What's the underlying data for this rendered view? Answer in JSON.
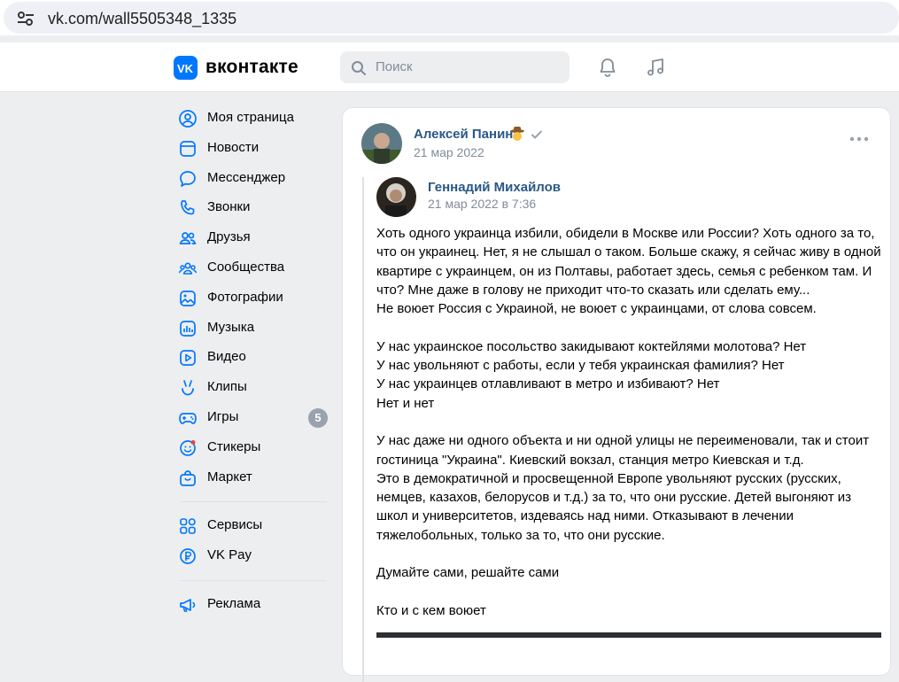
{
  "browser": {
    "url": "vk.com/wall5505348_1335"
  },
  "header": {
    "logo_text": "вконтакте",
    "search_placeholder": "Поиск",
    "accent": "#0077ff"
  },
  "sidebar": {
    "items": [
      {
        "label": "Моя страница",
        "icon": "user-circle-icon"
      },
      {
        "label": "Новости",
        "icon": "news-icon"
      },
      {
        "label": "Мессенджер",
        "icon": "message-icon"
      },
      {
        "label": "Звонки",
        "icon": "phone-icon"
      },
      {
        "label": "Друзья",
        "icon": "friends-icon"
      },
      {
        "label": "Сообщества",
        "icon": "communities-icon"
      },
      {
        "label": "Фотографии",
        "icon": "photo-icon"
      },
      {
        "label": "Музыка",
        "icon": "music-icon"
      },
      {
        "label": "Видео",
        "icon": "video-icon"
      },
      {
        "label": "Клипы",
        "icon": "clips-icon"
      },
      {
        "label": "Игры",
        "icon": "games-icon",
        "badge": "5"
      },
      {
        "label": "Стикеры",
        "icon": "stickers-icon"
      },
      {
        "label": "Маркет",
        "icon": "market-icon"
      }
    ],
    "items2": [
      {
        "label": "Сервисы",
        "icon": "services-icon"
      },
      {
        "label": "VK Pay",
        "icon": "vkpay-icon"
      }
    ],
    "items3": [
      {
        "label": "Реклама",
        "icon": "ads-icon"
      }
    ]
  },
  "post": {
    "author": "Алексей Панин",
    "date": "21 мар 2022",
    "repost": {
      "author": "Геннадий Михайлов",
      "date": "21 мар 2022 в 7:36",
      "paragraphs": [
        [
          "Хоть одного украинца избили, обидели в Москве или России? Хоть одного за то, что он украинец. Нет, я не слышал о таком. Больше скажу, я сейчас живу в одной квартире с украинцем, он из Полтавы, работает здесь, семья с ребенком там. И что? Мне даже в голову не приходит что-то сказать или сделать ему...",
          "Не воюет Россия с Украиной, не воюет с украинцами, от слова совсем."
        ],
        [
          "У нас украинское посольство закидывают коктейлями молотова? Нет",
          "У нас увольняют с работы, если у тебя украинская фамилия? Нет",
          "У нас украинцев отлавливают в метро и избивают? Нет",
          "Нет и нет"
        ],
        [
          "У нас даже ни одного объекта и ни одной улицы не переименовали, так и стоит гостиница \"Украина\". Киевский вокзал, станция метро Киевская и т.д.",
          "Это в демократичной и просвещенной Европе увольняют русских (русских, немцев, казахов, белорусов и т.д.) за то, что они русские. Детей выгоняют из школ и университетов, издеваясь над ними. Отказывают в лечении тяжелобольных, только за то, что они русские."
        ],
        [
          "Думайте сами, решайте сами"
        ],
        [
          "Кто и с кем воюет"
        ]
      ]
    }
  }
}
